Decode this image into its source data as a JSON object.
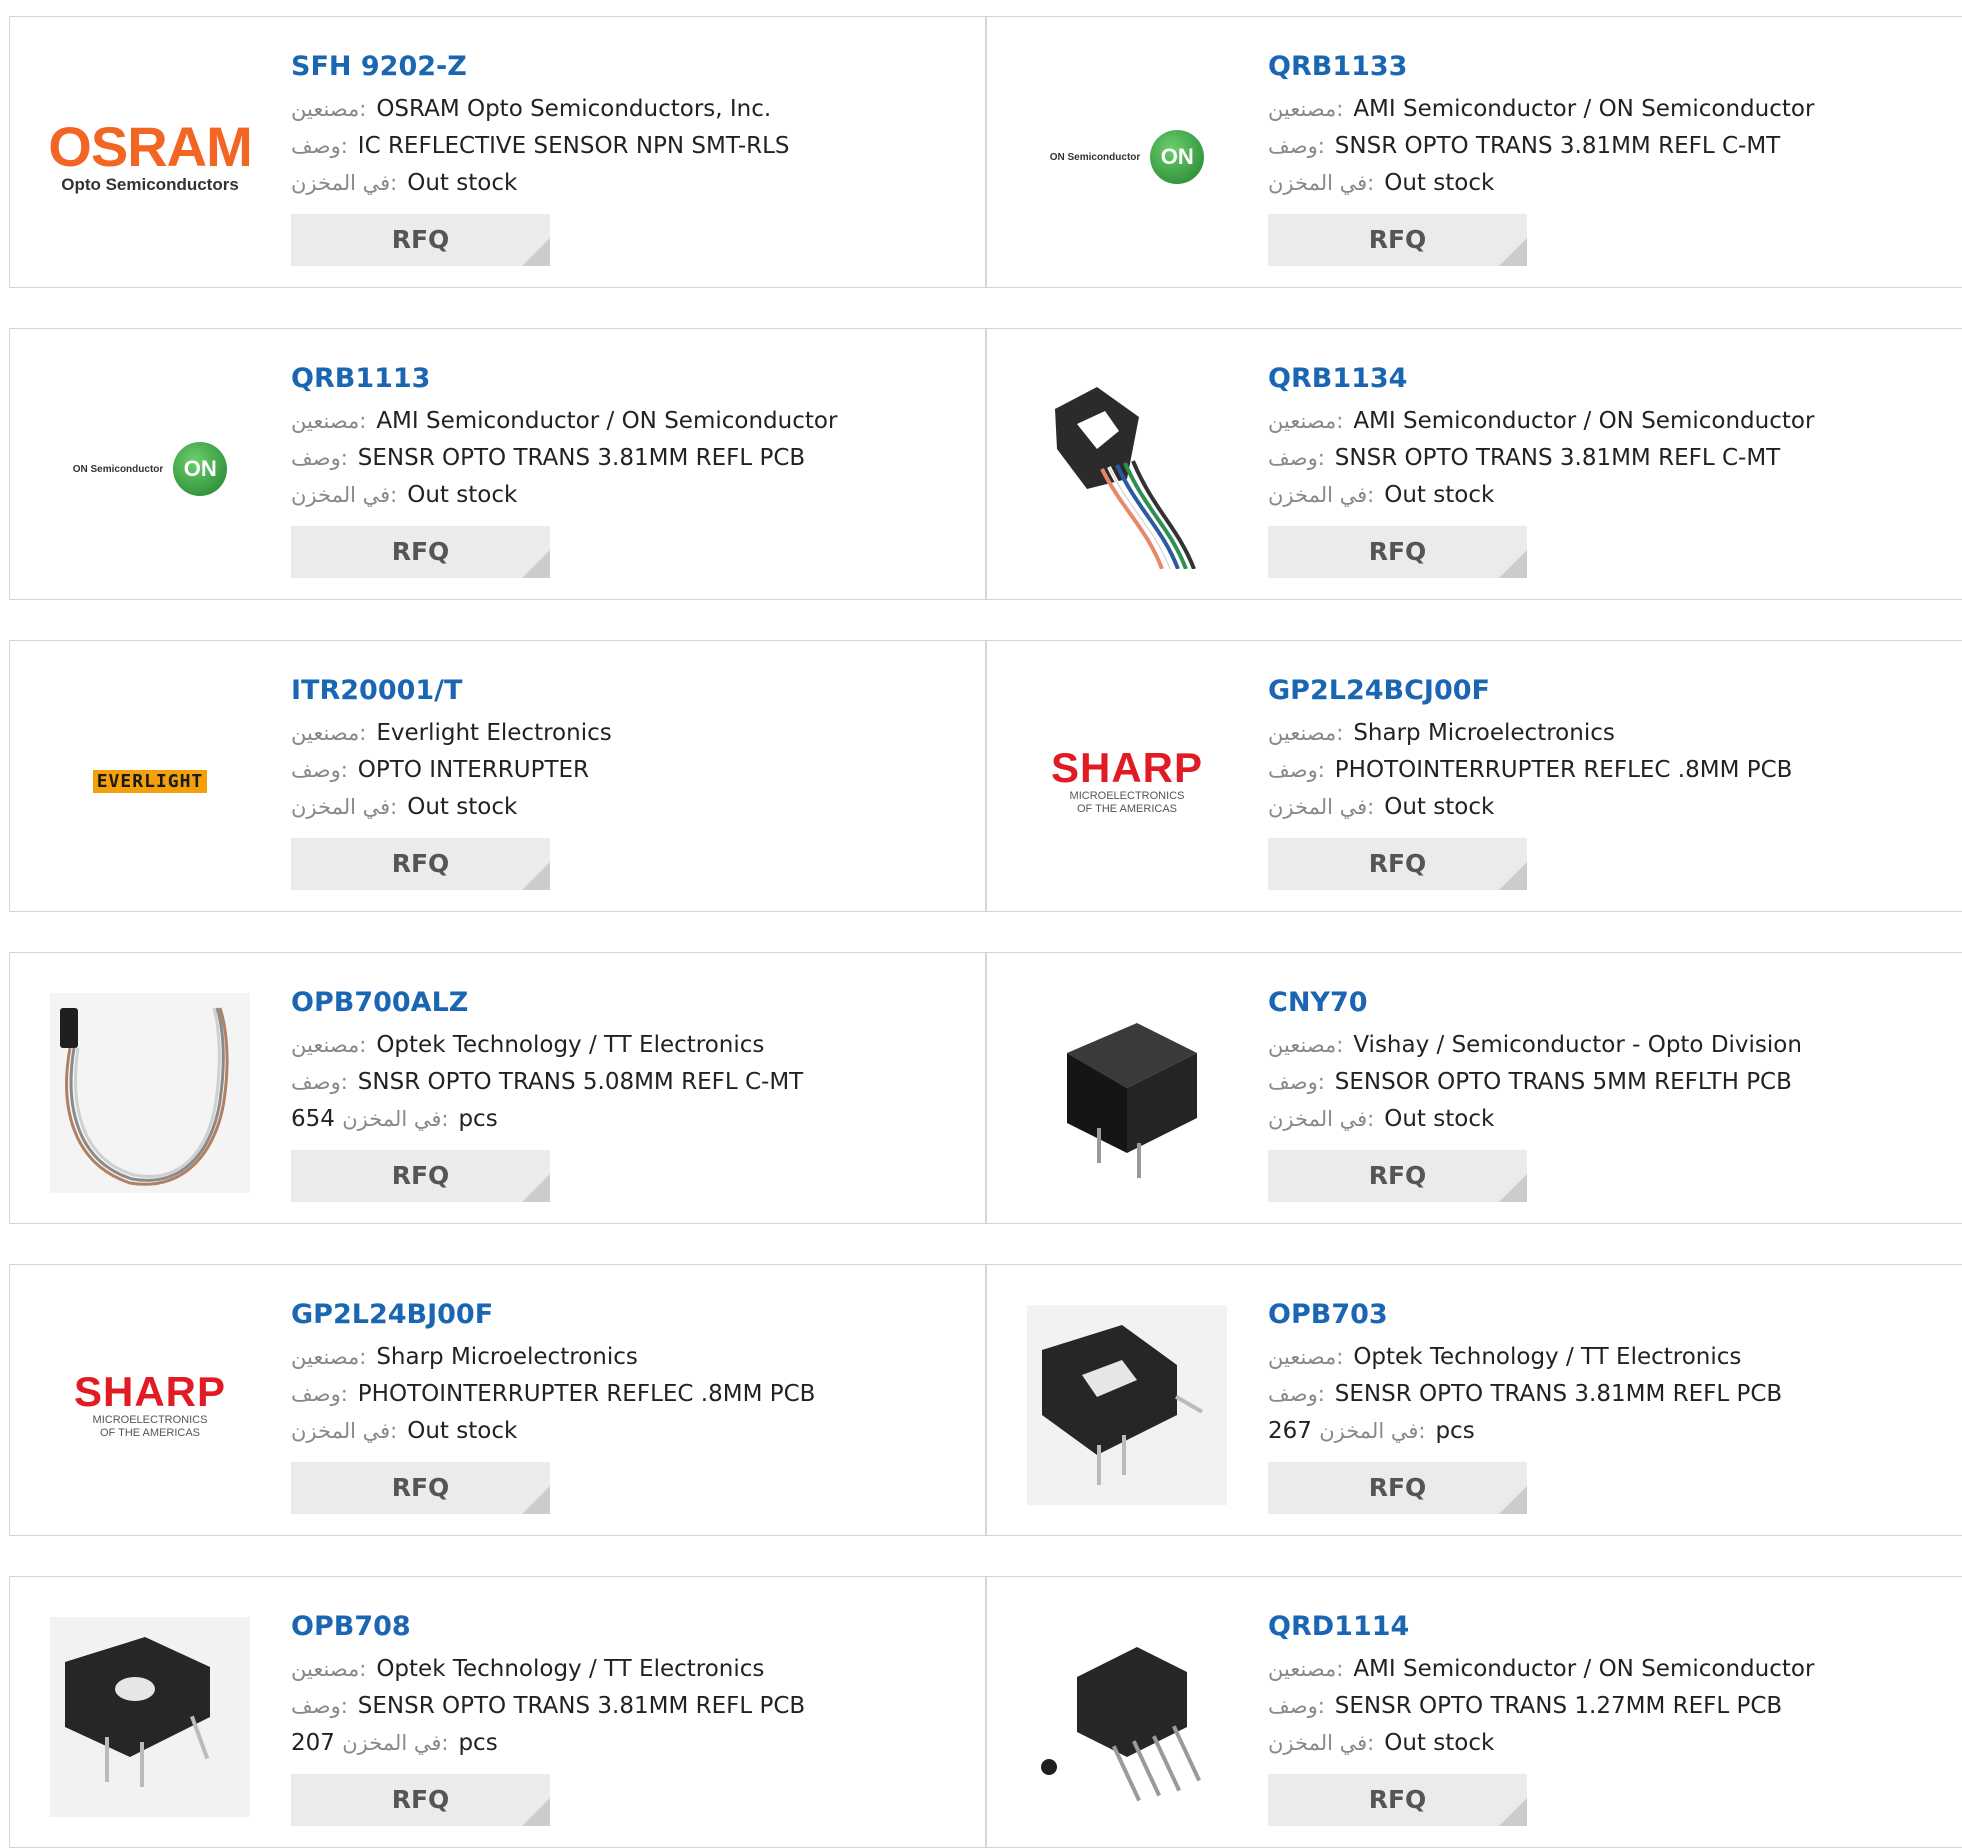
{
  "labels": {
    "manufacturer": "مصنعين:",
    "description": "وصف:",
    "stock": "في المخزن:",
    "rfq": "RFQ"
  },
  "products": [
    {
      "part": "SFH 9202-Z",
      "manufacturer": "OSRAM Opto Semiconductors, Inc.",
      "description": "IC REFLECTIVE SENSOR NPN SMT-RLS",
      "stock_value": "Out stock",
      "image": "osram-logo"
    },
    {
      "part": "QRB1133",
      "manufacturer": "AMI Semiconductor / ON Semiconductor",
      "description": "SNSR OPTO TRANS 3.81MM REFL C-MT",
      "stock_value": "Out stock",
      "image": "on-semiconductor-logo"
    },
    {
      "part": "QRB1113",
      "manufacturer": "AMI Semiconductor / ON Semiconductor",
      "description": "SENSR OPTO TRANS 3.81MM REFL PCB",
      "stock_value": "Out stock",
      "image": "on-semiconductor-logo"
    },
    {
      "part": "QRB1134",
      "manufacturer": "AMI Semiconductor / ON Semiconductor",
      "description": "SNSR OPTO TRANS 3.81MM REFL C-MT",
      "stock_value": "Out stock",
      "image": "reflective-sensor-with-leads"
    },
    {
      "part": "ITR20001/T",
      "manufacturer": "Everlight Electronics",
      "description": "OPTO INTERRUPTER",
      "stock_value": "Out stock",
      "image": "everlight-logo"
    },
    {
      "part": "GP2L24BCJ00F",
      "manufacturer": "Sharp Microelectronics",
      "description": "PHOTOINTERRUPTER REFLEC .8MM PCB",
      "stock_value": "Out stock",
      "image": "sharp-logo"
    },
    {
      "part": "OPB700ALZ",
      "manufacturer": "Optek Technology / TT Electronics",
      "description": "SNSR OPTO TRANS 5.08MM REFL C-MT",
      "stock_value": "654",
      "stock_unit": "pcs",
      "image": "sensor-with-cable"
    },
    {
      "part": "CNY70",
      "manufacturer": "Vishay / Semiconductor - Opto Division",
      "description": "SENSOR OPTO TRANS 5MM REFLTH PCB",
      "stock_value": "Out stock",
      "image": "cube-sensor"
    },
    {
      "part": "GP2L24BJ00F",
      "manufacturer": "Sharp Microelectronics",
      "description": "PHOTOINTERRUPTER REFLEC .8MM PCB",
      "stock_value": "Out stock",
      "image": "sharp-logo"
    },
    {
      "part": "OPB703",
      "manufacturer": "Optek Technology / TT Electronics",
      "description": "SENSR OPTO TRANS 3.81MM REFL PCB",
      "stock_value": "267",
      "stock_unit": "pcs",
      "image": "slotted-sensor"
    },
    {
      "part": "OPB708",
      "manufacturer": "Optek Technology / TT Electronics",
      "description": "SENSR OPTO TRANS 3.81MM REFL PCB",
      "stock_value": "207",
      "stock_unit": "pcs",
      "image": "slotted-sensor"
    },
    {
      "part": "QRD1114",
      "manufacturer": "AMI Semiconductor / ON Semiconductor",
      "description": "SENSR OPTO TRANS 1.27MM REFL PCB",
      "stock_value": "Out stock",
      "image": "four-pin-sensor"
    }
  ],
  "logos": {
    "osram": {
      "name": "OSRAM",
      "sub": "Opto Semiconductors"
    },
    "on": {
      "name": "ON Semiconductor",
      "mark": "ON"
    },
    "sharp": {
      "name": "SHARP",
      "sub1": "MICROELECTRONICS",
      "sub2": "OF THE AMERICAS"
    },
    "everlight": {
      "name": "EVERLIGHT"
    }
  },
  "colors": {
    "part_link": "#1a66b3",
    "osram_orange": "#f26522",
    "sharp_red": "#e01b23",
    "on_green": "#2f9e3f",
    "rfq_bg": "#ebebeb"
  }
}
